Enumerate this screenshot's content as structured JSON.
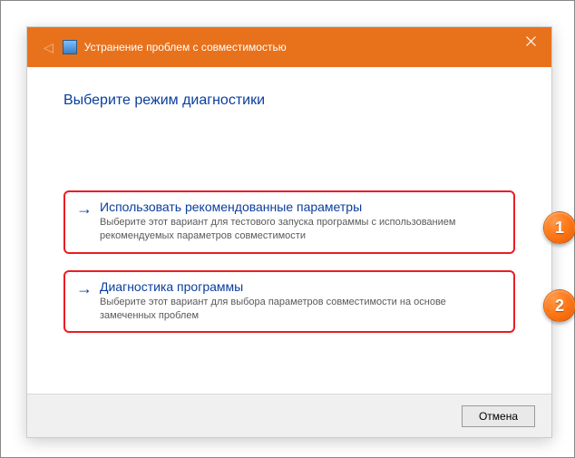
{
  "titlebar": {
    "title": "Устранение проблем с совместимостью"
  },
  "heading": "Выберите режим диагностики",
  "options": [
    {
      "title": "Использовать рекомендованные параметры",
      "desc": "Выберите этот вариант для тестового запуска программы с использованием рекомендуемых параметров совместимости"
    },
    {
      "title": "Диагностика программы",
      "desc": "Выберите этот вариант для выбора параметров совместимости на основе замеченных проблем"
    }
  ],
  "footer": {
    "cancel": "Отмена"
  },
  "badges": {
    "one": "1",
    "two": "2"
  }
}
